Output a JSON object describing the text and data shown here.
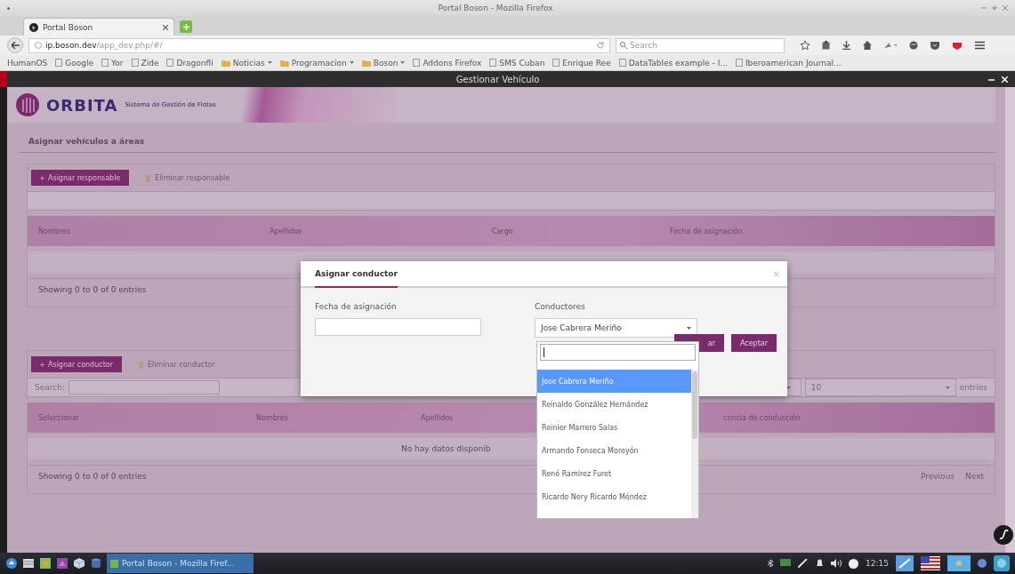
{
  "browser": {
    "title": "Portal Boson - Mozilla Firefox",
    "tab": {
      "label": "Portal Boson"
    },
    "url": {
      "host": "ip.boson.dev",
      "path": "/app_dev.php/#/"
    },
    "search": {
      "placeholder": "Search"
    },
    "bookmarks": [
      {
        "label": "HumanOS",
        "kind": "plain"
      },
      {
        "label": "Google",
        "kind": "link"
      },
      {
        "label": "Yor",
        "kind": "link"
      },
      {
        "label": "Zide",
        "kind": "link"
      },
      {
        "label": "Dragonfli",
        "kind": "link"
      },
      {
        "label": "Noticias",
        "kind": "folder"
      },
      {
        "label": "Programacion",
        "kind": "folder"
      },
      {
        "label": "Boson",
        "kind": "folder"
      },
      {
        "label": "Addons Firefox",
        "kind": "link"
      },
      {
        "label": "SMS Cuban",
        "kind": "link"
      },
      {
        "label": "Enrique Ree",
        "kind": "link"
      },
      {
        "label": "DataTables example - I...",
        "kind": "link"
      },
      {
        "label": "Iberoamerican Journal...",
        "kind": "link"
      }
    ]
  },
  "app": {
    "title": "Gestionar Vehículo",
    "logo": "ORBITA",
    "tagline": "Sistema de Gestión de Flotas",
    "section_title": "Asignar vehículos a áreas",
    "panels": [
      {
        "buttons": [
          {
            "label": "Asignar responsable",
            "disabled": false
          },
          {
            "label": "Eliminar responsable",
            "disabled": true
          }
        ],
        "columns": [
          "Nombres",
          "Apellidos",
          "Cargo",
          "Fecha de asignación"
        ],
        "info": "Showing 0 to 0 of 0 entries"
      },
      {
        "buttons": [
          {
            "label": "Asignar conductor",
            "disabled": false
          },
          {
            "label": "Eliminar conductor",
            "disabled": true
          }
        ],
        "search_label": "Search:",
        "length": {
          "value": "10",
          "suffix": "entries"
        },
        "columns": [
          "Seleccionar",
          "Nombres",
          "Apellidos",
          "cencia de conducción"
        ],
        "empty": "No hay datos disponib",
        "info": "Showing 0 to 0 of 0 entries",
        "paging": [
          {
            "label": "Previous",
            "disabled": true
          },
          {
            "label": "Next",
            "disabled": true
          }
        ]
      }
    ],
    "modal": {
      "title": "Asignar conductor",
      "close": "×",
      "date": {
        "label": "Fecha de asignación"
      },
      "drivers": {
        "label": "Conductores",
        "value": "Jose Cabrera Meriño"
      },
      "buttons": [
        {
          "label": "ar",
          "kind": "cancel"
        },
        {
          "label": "Aceptar",
          "kind": "primary"
        }
      ],
      "dropdown": {
        "options": [
          {
            "label": "Jose Cabrera Meriño",
            "selected": true
          },
          {
            "label": "Reinaldo González Hernández",
            "selected": false
          },
          {
            "label": "Reinier Marrero Salas",
            "selected": false
          },
          {
            "label": "Armando Fonseca Moreyón",
            "selected": false
          },
          {
            "label": "René Ramírez Furet",
            "selected": false
          },
          {
            "label": "Ricardo Nery Ricardo Méndez",
            "selected": false
          }
        ]
      }
    }
  },
  "taskbar": {
    "task": "Portal Boson - Mozilla Firef...",
    "clock": "12:15"
  }
}
